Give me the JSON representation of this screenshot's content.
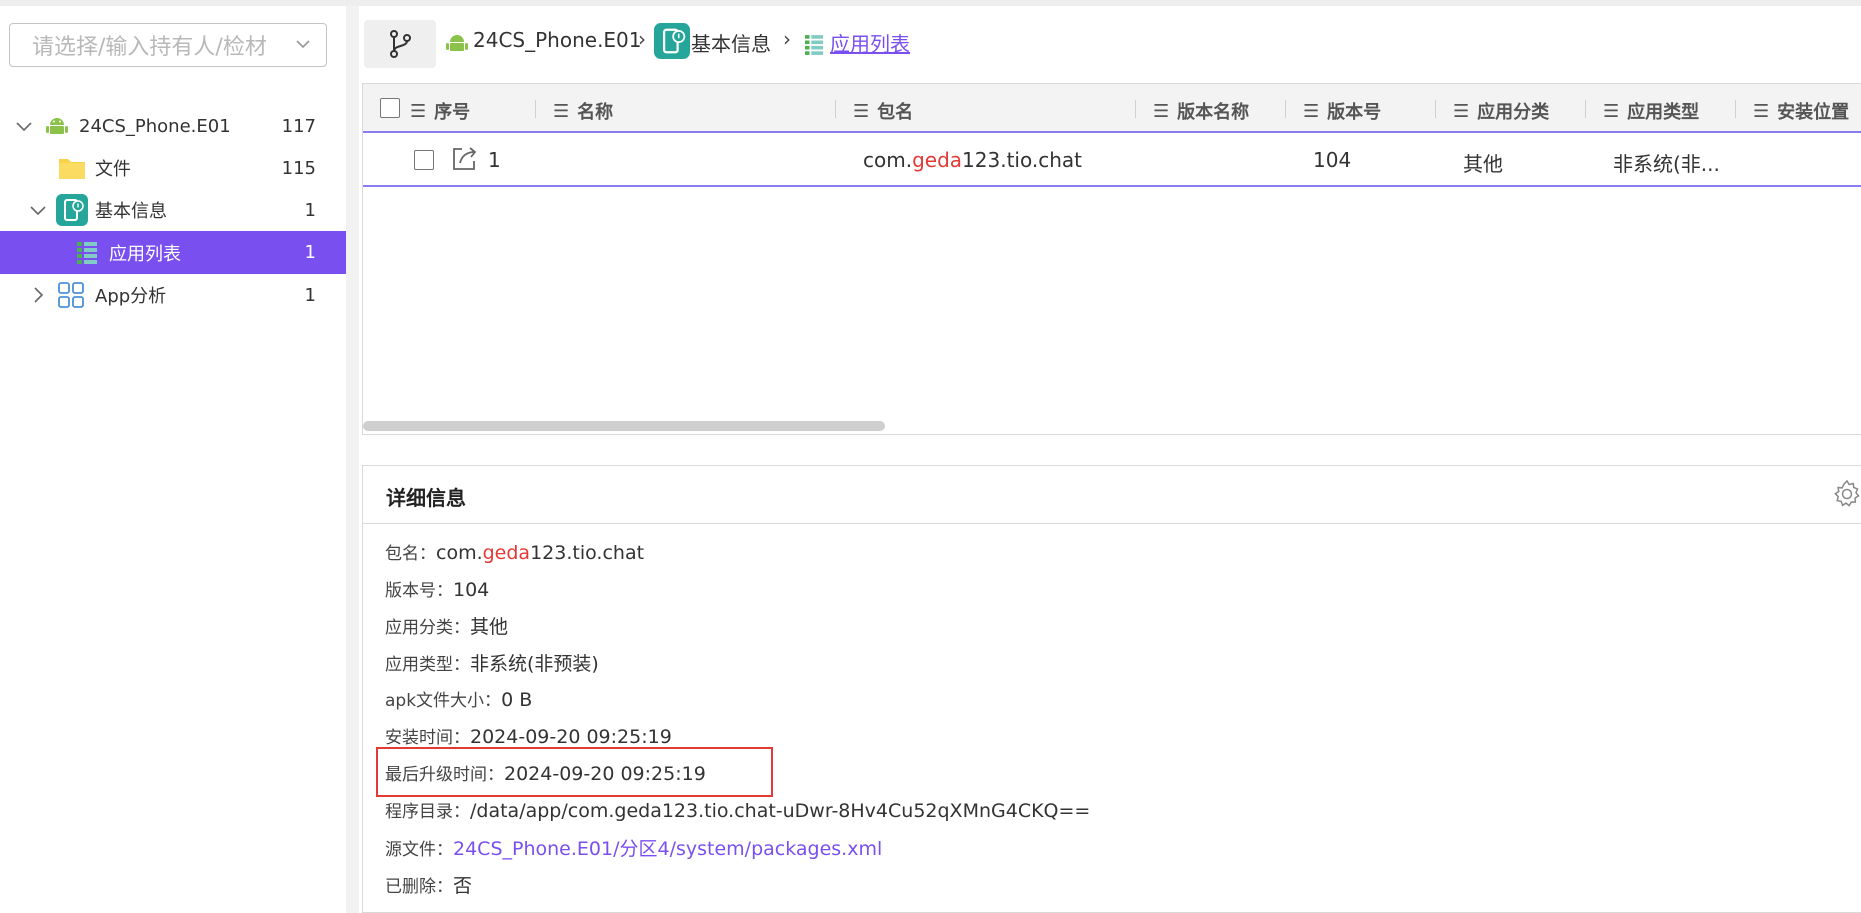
{
  "colors": {
    "accent": "#7a4ff0",
    "highlight": "#e53935",
    "android": "#8bc34a",
    "teal": "#26a69a"
  },
  "sidebar": {
    "owner_select_placeholder": "请选择/输入持有人/检材",
    "tree": [
      {
        "label": "24CS_Phone.E01",
        "count": "117",
        "icon": "android-icon",
        "expanded": true
      },
      {
        "label": "文件",
        "count": "115",
        "icon": "folder-icon"
      },
      {
        "label": "基本信息",
        "count": "1",
        "icon": "phone-info-icon",
        "expanded": true
      },
      {
        "label": "应用列表",
        "count": "1",
        "icon": "app-list-icon",
        "selected": true
      },
      {
        "label": "App分析",
        "count": "1",
        "icon": "grid-icon",
        "expanded": false
      }
    ]
  },
  "breadcrumb": {
    "items": [
      "24CS_Phone.E01",
      "基本信息",
      "应用列表"
    ],
    "separator": "›"
  },
  "table": {
    "columns": [
      "序号",
      "名称",
      "包名",
      "版本名称",
      "版本号",
      "应用分类",
      "应用类型",
      "安装位置"
    ],
    "rows": [
      {
        "index": "1",
        "name": "",
        "package_prefix": "com.",
        "package_highlight": "geda",
        "package_suffix": "123.tio.chat",
        "version_name": "",
        "version_code": "104",
        "category": "其他",
        "type": "非系统(非..."
      }
    ]
  },
  "details": {
    "title": "详细信息",
    "fields": {
      "package": {
        "label": "包名：",
        "prefix": "com.",
        "highlight": "geda",
        "suffix": "123.tio.chat"
      },
      "version_code": {
        "label": "版本号：",
        "value": "104"
      },
      "category": {
        "label": "应用分类：",
        "value": "其他"
      },
      "type": {
        "label": "应用类型：",
        "value": "非系统(非预装)"
      },
      "apk_size": {
        "label": "apk文件大小：",
        "value": "0 B"
      },
      "install_time": {
        "label": "安装时间：",
        "value": "2024-09-20 09:25:19"
      },
      "last_upgrade": {
        "label": "最后升级时间：",
        "value": "2024-09-20 09:25:19"
      },
      "program_dir": {
        "label": "程序目录：",
        "value": "/data/app/com.geda123.tio.chat-uDwr-8Hv4Cu52qXMnG4CKQ=="
      },
      "source_file": {
        "label": "源文件：",
        "value": "24CS_Phone.E01/分区4/system/packages.xml"
      },
      "deleted": {
        "label": "已删除：",
        "value": "否"
      }
    }
  }
}
